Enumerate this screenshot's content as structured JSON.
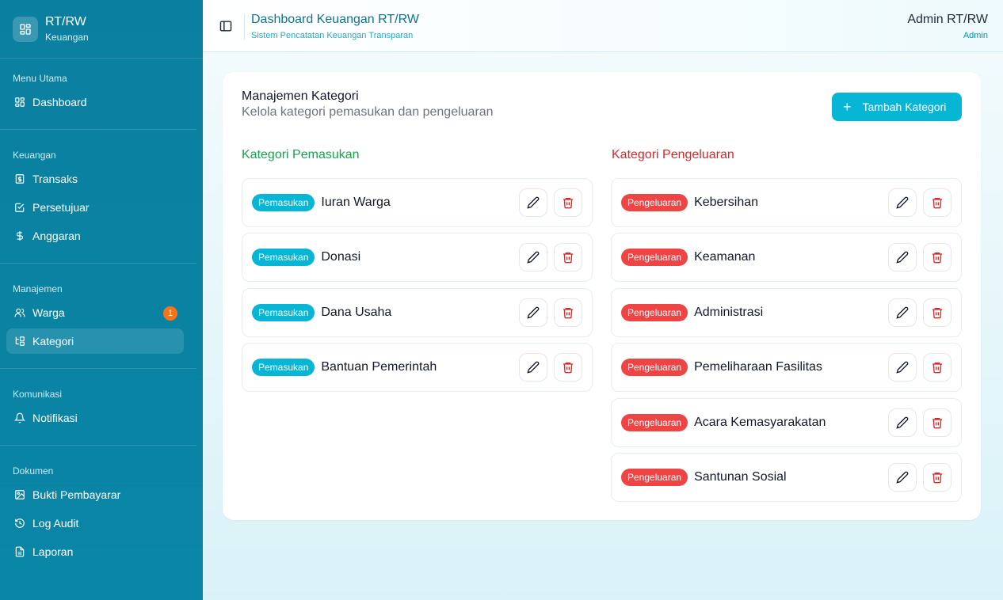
{
  "brand": {
    "title": "RT/RW",
    "subtitle": "Keuangan"
  },
  "sidebar": {
    "groups": [
      {
        "label": "Menu Utama",
        "items": [
          {
            "label": "Dashboard",
            "icon": "dashboard-icon"
          }
        ]
      },
      {
        "label": "Keuangan",
        "items": [
          {
            "label": "Transaks",
            "icon": "receipt-icon"
          },
          {
            "label": "Persetujuar",
            "icon": "check-square-icon"
          },
          {
            "label": "Anggaran",
            "icon": "dollar-icon"
          }
        ]
      },
      {
        "label": "Manajemen",
        "items": [
          {
            "label": "Warga",
            "icon": "users-icon",
            "badge": "1"
          },
          {
            "label": "Kategori",
            "icon": "category-icon",
            "active": true
          }
        ]
      },
      {
        "label": "Komunikasi",
        "items": [
          {
            "label": "Notifikasi",
            "icon": "bell-icon"
          }
        ]
      },
      {
        "label": "Dokumen",
        "items": [
          {
            "label": "Bukti Pembayarar",
            "icon": "image-icon"
          },
          {
            "label": "Log Audit",
            "icon": "history-icon"
          },
          {
            "label": "Laporan",
            "icon": "file-icon"
          }
        ]
      }
    ]
  },
  "header": {
    "title": "Dashboard Keuangan RT/RW",
    "subtitle": "Sistem Pencatatan Keuangan Transparan",
    "user_name": "Admin RT/RW",
    "user_role": "Admin"
  },
  "card": {
    "title": "Manajemen Kategori",
    "subtitle": "Kelola kategori pemasukan dan pengeluaran",
    "add_button": "Tambah Kategori"
  },
  "income": {
    "title": "Kategori Pemasukan",
    "tag": "Pemasukan",
    "items": [
      "Iuran Warga",
      "Donasi",
      "Dana Usaha",
      "Bantuan Pemerintah"
    ]
  },
  "expense": {
    "title": "Kategori Pengeluaran",
    "tag": "Pengeluaran",
    "items": [
      "Kebersihan",
      "Keamanan",
      "Administrasi",
      "Pemeliharaan Fasilitas",
      "Acara Kemasyarakatan",
      "Santunan Sosial"
    ]
  },
  "colors": {
    "accent": "#06b6d4",
    "sidebar": "#0b7f9f",
    "income": "#16a34a",
    "expense": "#dc2626",
    "badge": "#f97316"
  }
}
